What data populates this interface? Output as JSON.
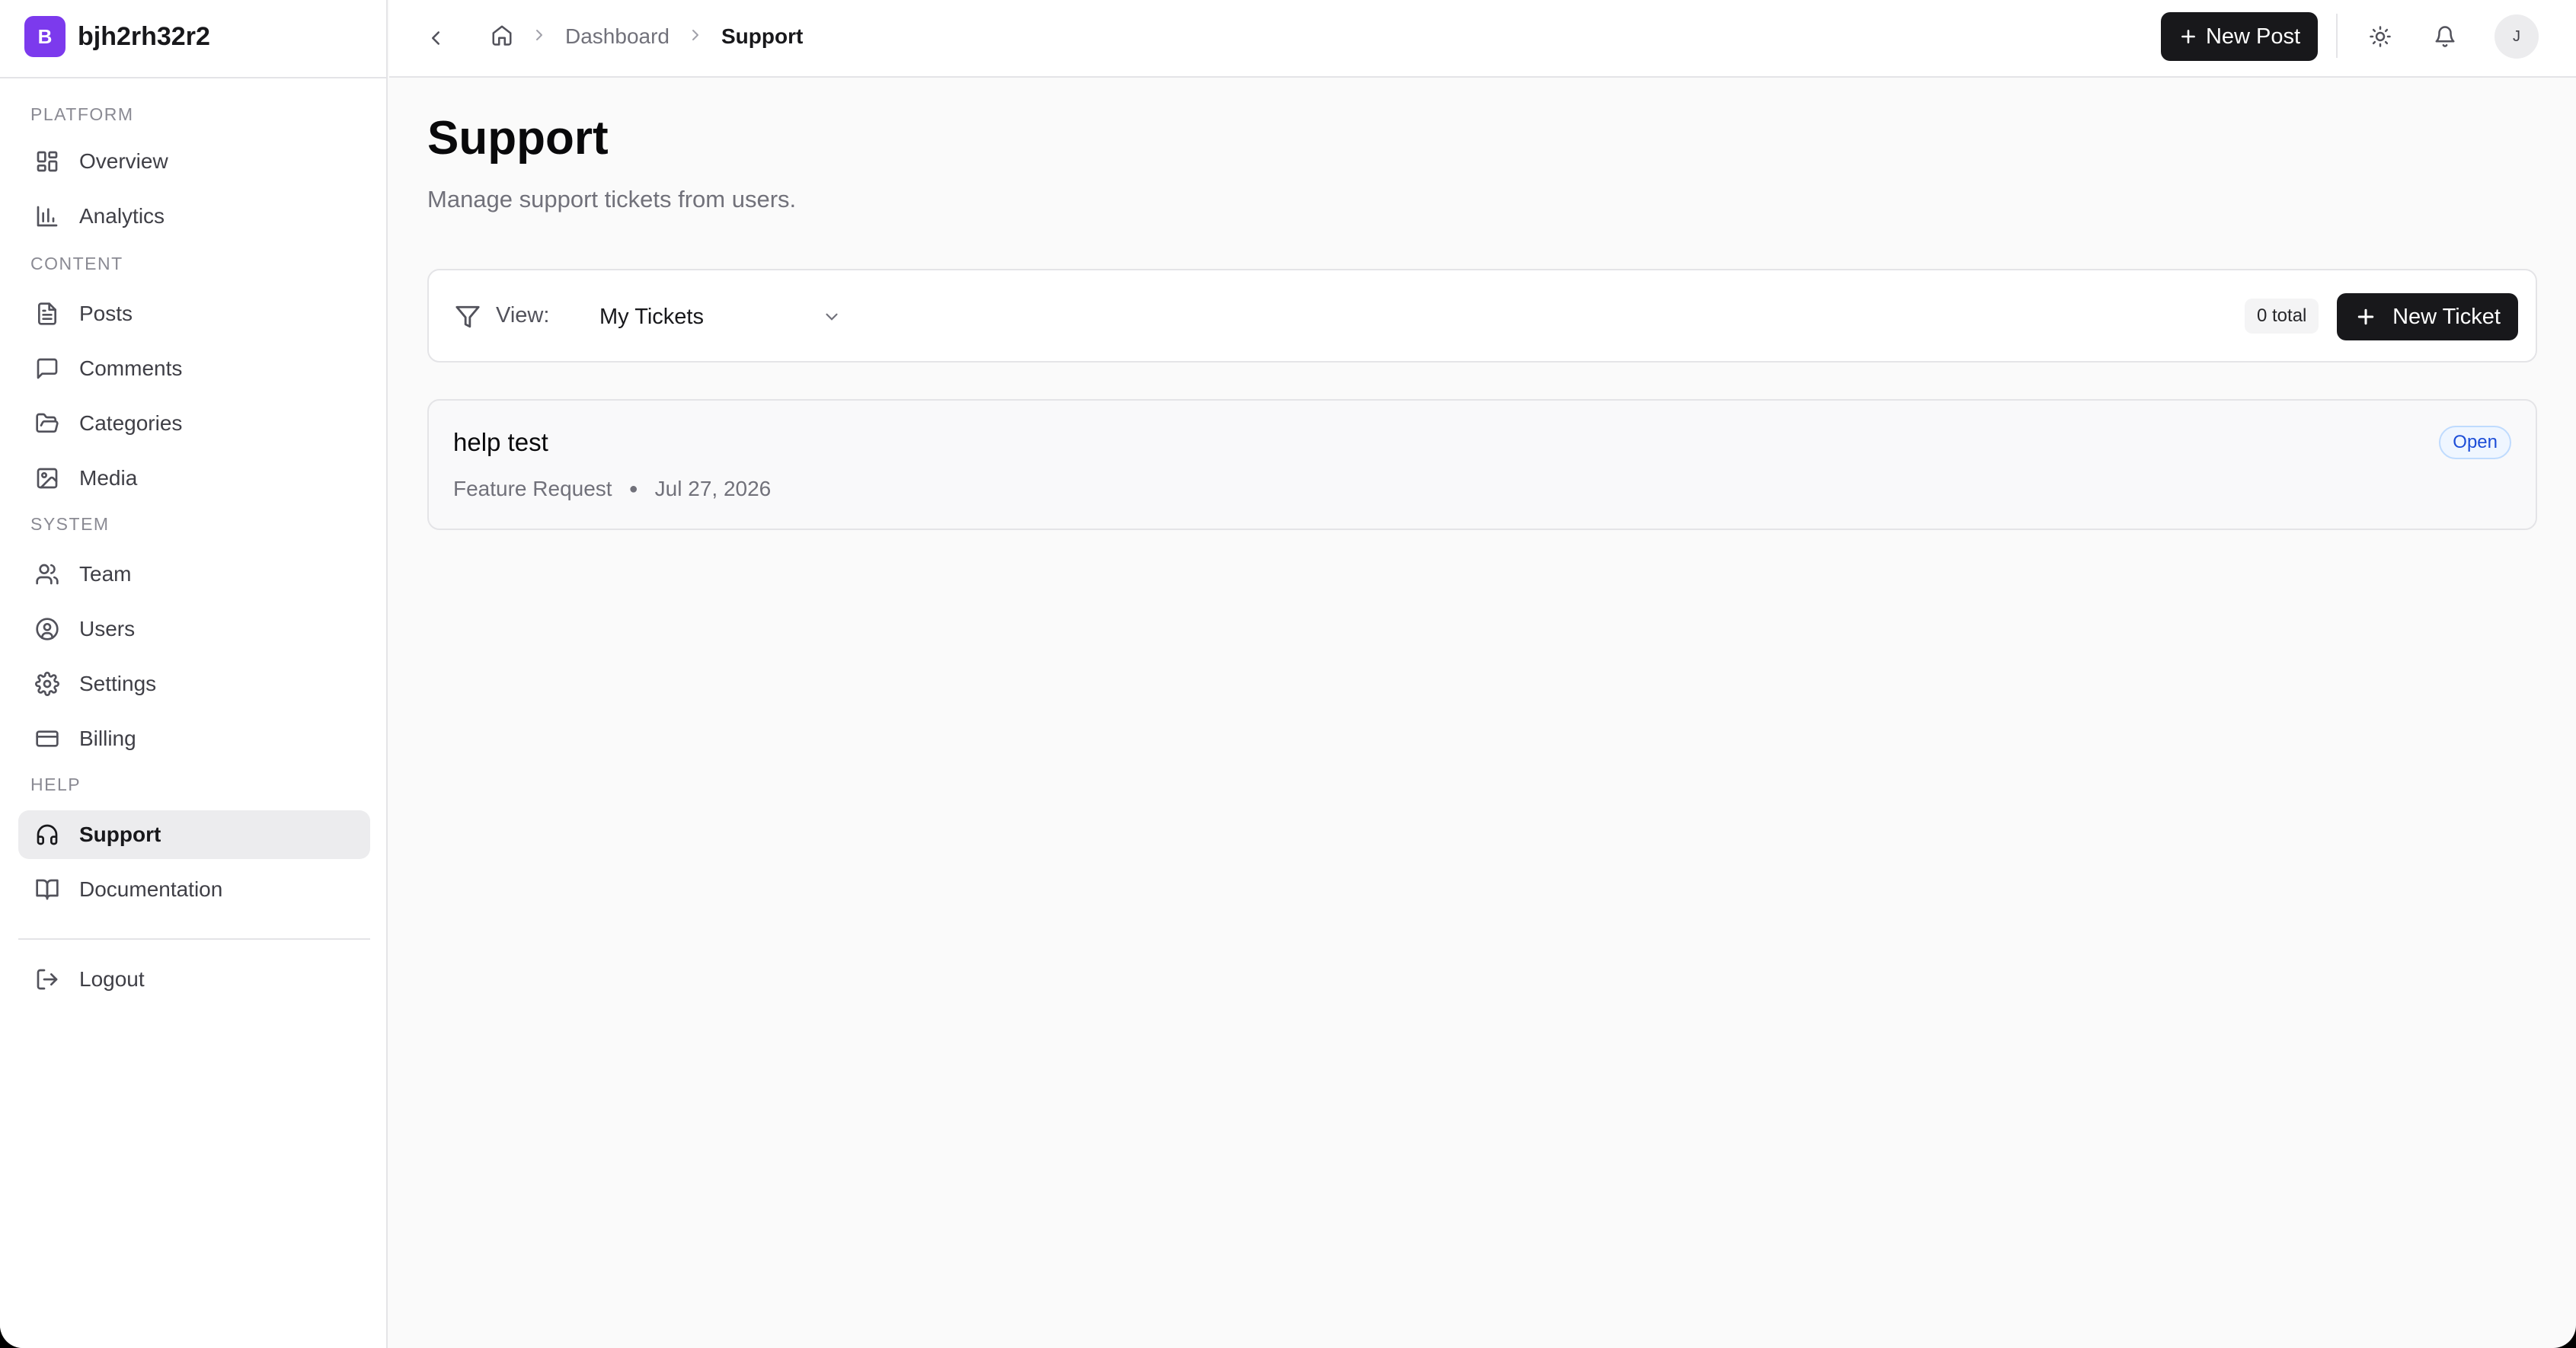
{
  "brand": {
    "initial": "B",
    "name": "bjh2rh32r2",
    "color": "#7c3aed"
  },
  "sidebar": {
    "sections": [
      {
        "label": "PLATFORM"
      },
      {
        "label": "CONTENT"
      },
      {
        "label": "SYSTEM"
      },
      {
        "label": "HELP"
      }
    ],
    "items": [
      {
        "label": "Overview",
        "icon": "layout-grid-icon"
      },
      {
        "label": "Analytics",
        "icon": "bar-chart-icon"
      },
      {
        "label": "Posts",
        "icon": "file-text-icon"
      },
      {
        "label": "Comments",
        "icon": "message-square-icon"
      },
      {
        "label": "Categories",
        "icon": "folder-open-icon"
      },
      {
        "label": "Media",
        "icon": "image-icon"
      },
      {
        "label": "Team",
        "icon": "users-icon"
      },
      {
        "label": "Users",
        "icon": "user-circle-icon"
      },
      {
        "label": "Settings",
        "icon": "gear-icon"
      },
      {
        "label": "Billing",
        "icon": "credit-card-icon"
      },
      {
        "label": "Support",
        "icon": "headphones-icon",
        "active": true
      },
      {
        "label": "Documentation",
        "icon": "book-open-icon"
      }
    ],
    "logout": {
      "label": "Logout",
      "icon": "logout-icon"
    }
  },
  "header": {
    "breadcrumb": [
      {
        "label": "Dashboard"
      },
      {
        "label": "Support"
      }
    ],
    "new_post_label": "New Post",
    "avatar_initial": "J"
  },
  "main": {
    "title": "Support",
    "subtitle": "Manage support tickets from users.",
    "filter": {
      "view_label": "View:",
      "selected": "My Tickets",
      "count": "0 total",
      "new_ticket_label": "New Ticket"
    },
    "tickets": [
      {
        "title": "help test",
        "category": "Feature Request",
        "date": "Jul 27, 2026",
        "status": "Open"
      }
    ]
  },
  "colors": {
    "accent": "#18181b",
    "status_open": "#1d4ed8",
    "background": "#fafafa"
  }
}
